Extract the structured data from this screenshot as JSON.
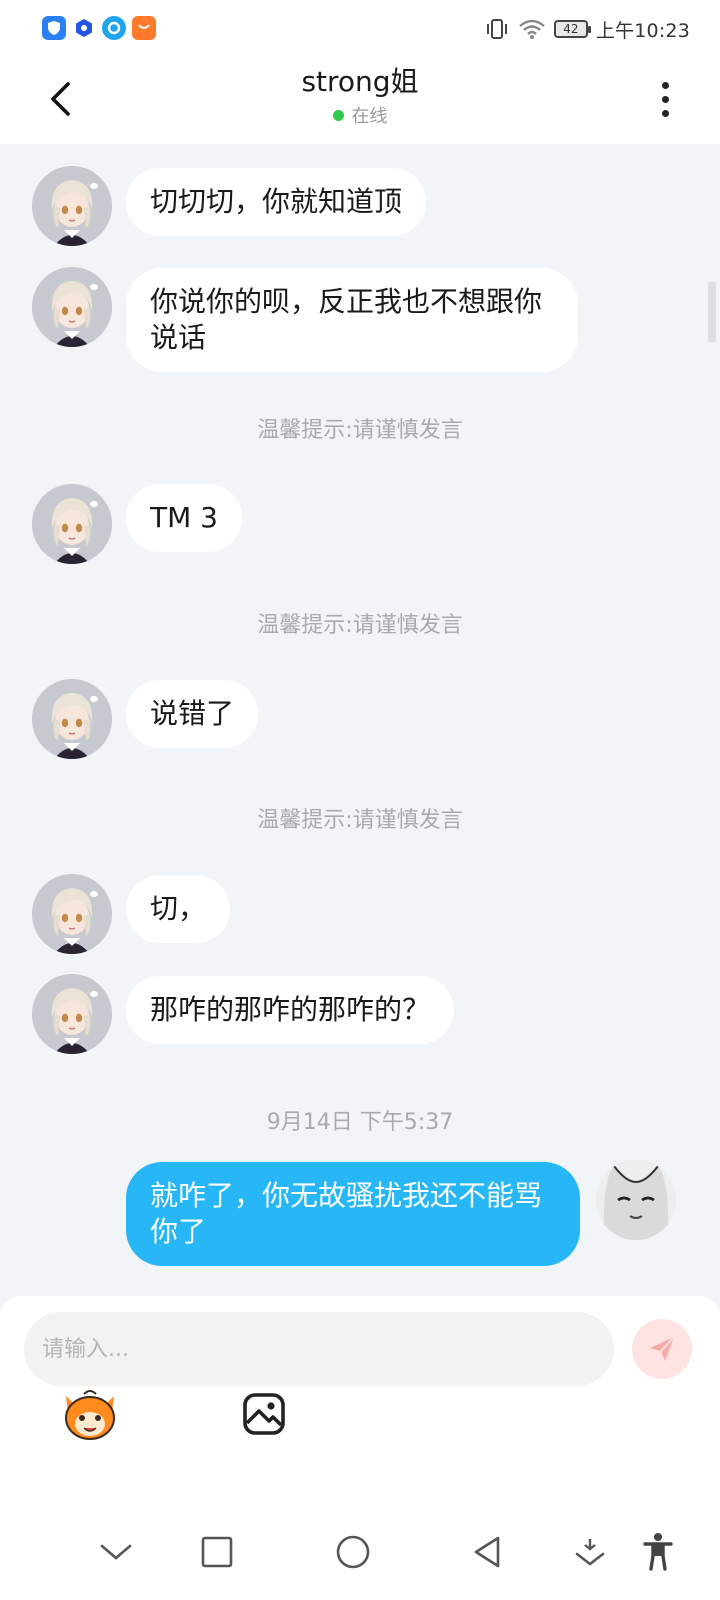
{
  "status_bar": {
    "apps": [
      "app-blue-shield-icon",
      "app-blue-hexagon-icon",
      "app-search-bubble-icon",
      "app-orange-bag-icon"
    ],
    "battery": "42",
    "time": "上午10:23"
  },
  "header": {
    "title": "strong姐",
    "presence": "在线"
  },
  "messages": [
    {
      "from": "other",
      "text": "切切切，你就知道顶"
    },
    {
      "from": "other",
      "text": "你说你的呗，反正我也不想跟你说话"
    },
    {
      "type": "notice",
      "text": "温馨提示:请谨慎发言"
    },
    {
      "from": "other",
      "text": "TM 3"
    },
    {
      "type": "notice",
      "text": "温馨提示:请谨慎发言"
    },
    {
      "from": "other",
      "text": "说错了"
    },
    {
      "type": "notice",
      "text": "温馨提示:请谨慎发言"
    },
    {
      "from": "other",
      "text": "切，"
    },
    {
      "from": "other",
      "text": "那咋的那咋的那咋的？"
    },
    {
      "type": "timestamp",
      "text": "9月14日 下午5:37"
    },
    {
      "from": "self",
      "text": "就咋了，你无故骚扰我还不能骂你了"
    }
  ],
  "composer": {
    "placeholder": "请输入...",
    "tools": [
      "emoji-mascot-icon",
      "image-icon"
    ]
  },
  "colors": {
    "self_bubble": "#27b6f6",
    "online_dot": "#33c94a",
    "background": "#f2f5f8"
  }
}
